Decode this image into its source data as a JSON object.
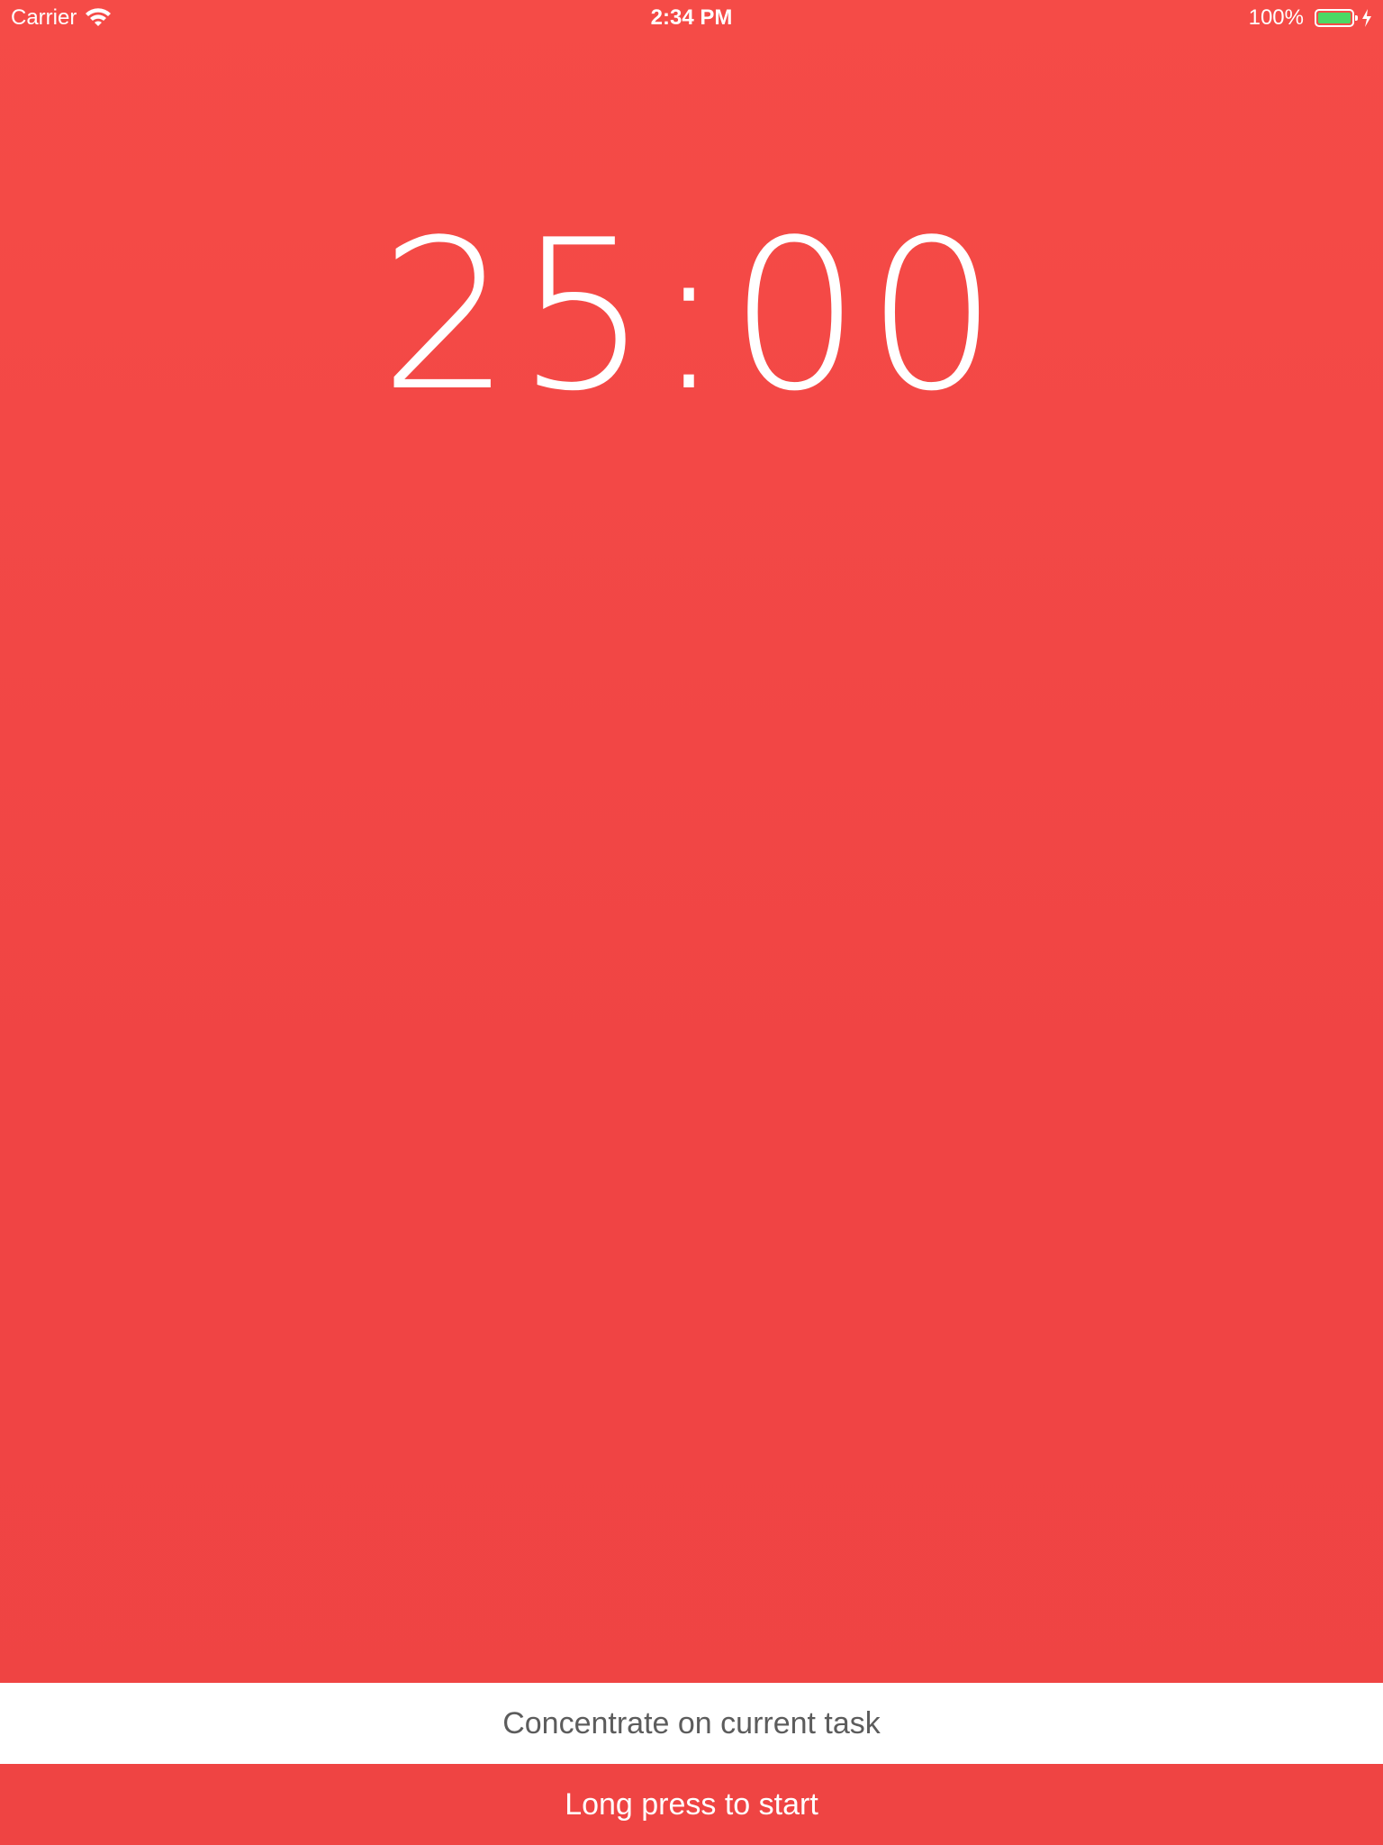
{
  "status_bar": {
    "carrier": "Carrier",
    "time": "2:34 PM",
    "battery_percent": "100%",
    "battery_level": 1.0,
    "battery_color": "#4cd964"
  },
  "timer": {
    "display": "25:00"
  },
  "task": {
    "text": "Concentrate on current task"
  },
  "start": {
    "label": "Long press to start"
  },
  "colors": {
    "background": "#f24a46",
    "task_text": "#5c5c5c"
  }
}
